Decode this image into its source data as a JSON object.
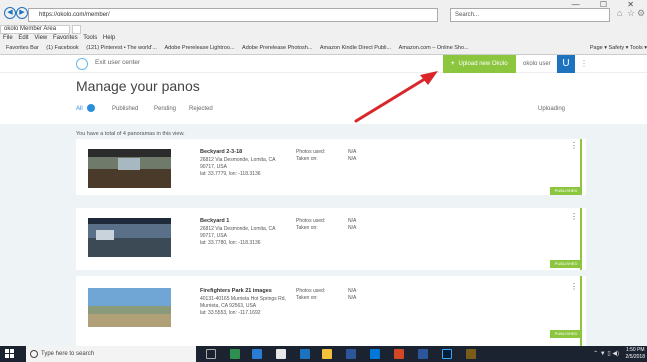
{
  "browser": {
    "window_controls": "—  ☐  ✕",
    "url": "https://okolo.com/member/",
    "search_placeholder": "Search...",
    "tab_title": "okolo Member Area",
    "menu": [
      "File",
      "Edit",
      "View",
      "Favorites",
      "Tools",
      "Help"
    ],
    "favorites": [
      "Favorites Bar",
      "(1) Facebook",
      "(121) Pinterest • The world'...",
      "Adobe Prerelease Lightroo...",
      "Adobe Prerelease Photosh...",
      "Amazon Kindle Direct Publi...",
      "Amazon.com – Online Sho..."
    ],
    "toolbar_right": [
      "Page",
      "Safety",
      "Tools"
    ]
  },
  "app": {
    "exit_label": "Exit user center",
    "upload_label": "Upload new Okolo",
    "user_label": "okolo user",
    "logo_glyph": "U",
    "page_title": "Manage your panos",
    "tabs": [
      {
        "label": "All",
        "badge": ""
      },
      {
        "label": "Published"
      },
      {
        "label": "Pending"
      },
      {
        "label": "Rejected"
      }
    ],
    "uploading_label": "Uploading",
    "total_text": "You have a total of 4 panoramas in this view.",
    "accent": "#8cc63f",
    "brand": "#1e73be"
  },
  "panos": [
    {
      "title": "Beckyard 2-3-18",
      "address": "26812 Via Desmonde, Lomita, CA 90717, USA",
      "latlon": "lat: 33.7779, lon: -118.3136",
      "photos_label": "Photos used:",
      "taken_label": "Taken on:",
      "photos_value": "N/A",
      "taken_value": "N/A",
      "status": "PUBLISHED"
    },
    {
      "title": "Beckyard 1",
      "address": "26812 Via Desmonde, Lomita, CA 90717, USA",
      "latlon": "lat: 33.7780, lon: -118.3136",
      "photos_label": "Photos used:",
      "taken_label": "Taken on:",
      "photos_value": "N/A",
      "taken_value": "N/A",
      "status": "PUBLISHED"
    },
    {
      "title": "Firefighters Park 21 images",
      "address": "40131-40165 Murrieta Hot Springs Rd, Murrieta, CA 92563, USA",
      "latlon": "lat: 33.5553, lon: -117.1692",
      "photos_label": "Photos used:",
      "taken_label": "Taken on:",
      "photos_value": "N/A",
      "taken_value": "N/A",
      "status": "PUBLISHED"
    }
  ],
  "taskbar": {
    "search_placeholder": "Type here to search",
    "time": "1:50 PM",
    "date": "2/5/2018"
  }
}
